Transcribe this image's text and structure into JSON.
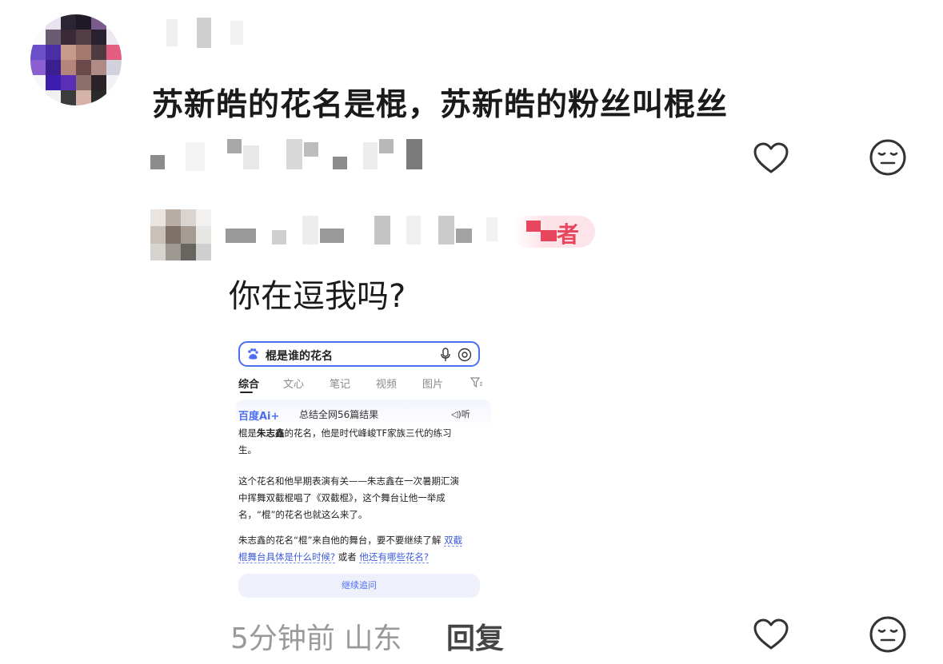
{
  "comment": {
    "text": "苏新皓的花名是棍，苏新皓的粉丝叫棍丝"
  },
  "reply": {
    "author_badge": "者",
    "text": "你在逗我吗?"
  },
  "embedded_screenshot": {
    "search_query": "棍是谁的花名",
    "tabs": [
      "综合",
      "文心",
      "笔记",
      "视频",
      "图片"
    ],
    "ai_logo": "百度Ai+",
    "ai_summary": "总结全网56篇结果",
    "listen_label": "◁)听",
    "para1_prefix": "棍是",
    "para1_name": "朱志鑫",
    "para1_line1_rest": "的花名，他是时代峰峻TF家族三代的练习",
    "para1_line2": "生。",
    "para2_lines": [
      "这个花名和他早期表演有关——朱志鑫在一次暑期汇演",
      "中挥舞双截棍唱了《双截棍》，这个舞台让他一举成",
      "名，“棍”的花名也就这么来了。"
    ],
    "para3_line1": "朱志鑫的花名“棍”来自他的舞台，要不要继续了解",
    "para3_link1a": "双截",
    "para3_link1b": "棍舞台具体是什么时候?",
    "para3_or": " 或者 ",
    "para3_link2": "他还有哪些花名?",
    "continue_label": "继续追问"
  },
  "footer": {
    "time_location": "5分钟前 山东",
    "reply_label": "回复"
  },
  "colors": {
    "accent_blue": "#4e6ef2",
    "author_pink": "#e8455e",
    "muted_gray": "#9a9a9a"
  }
}
